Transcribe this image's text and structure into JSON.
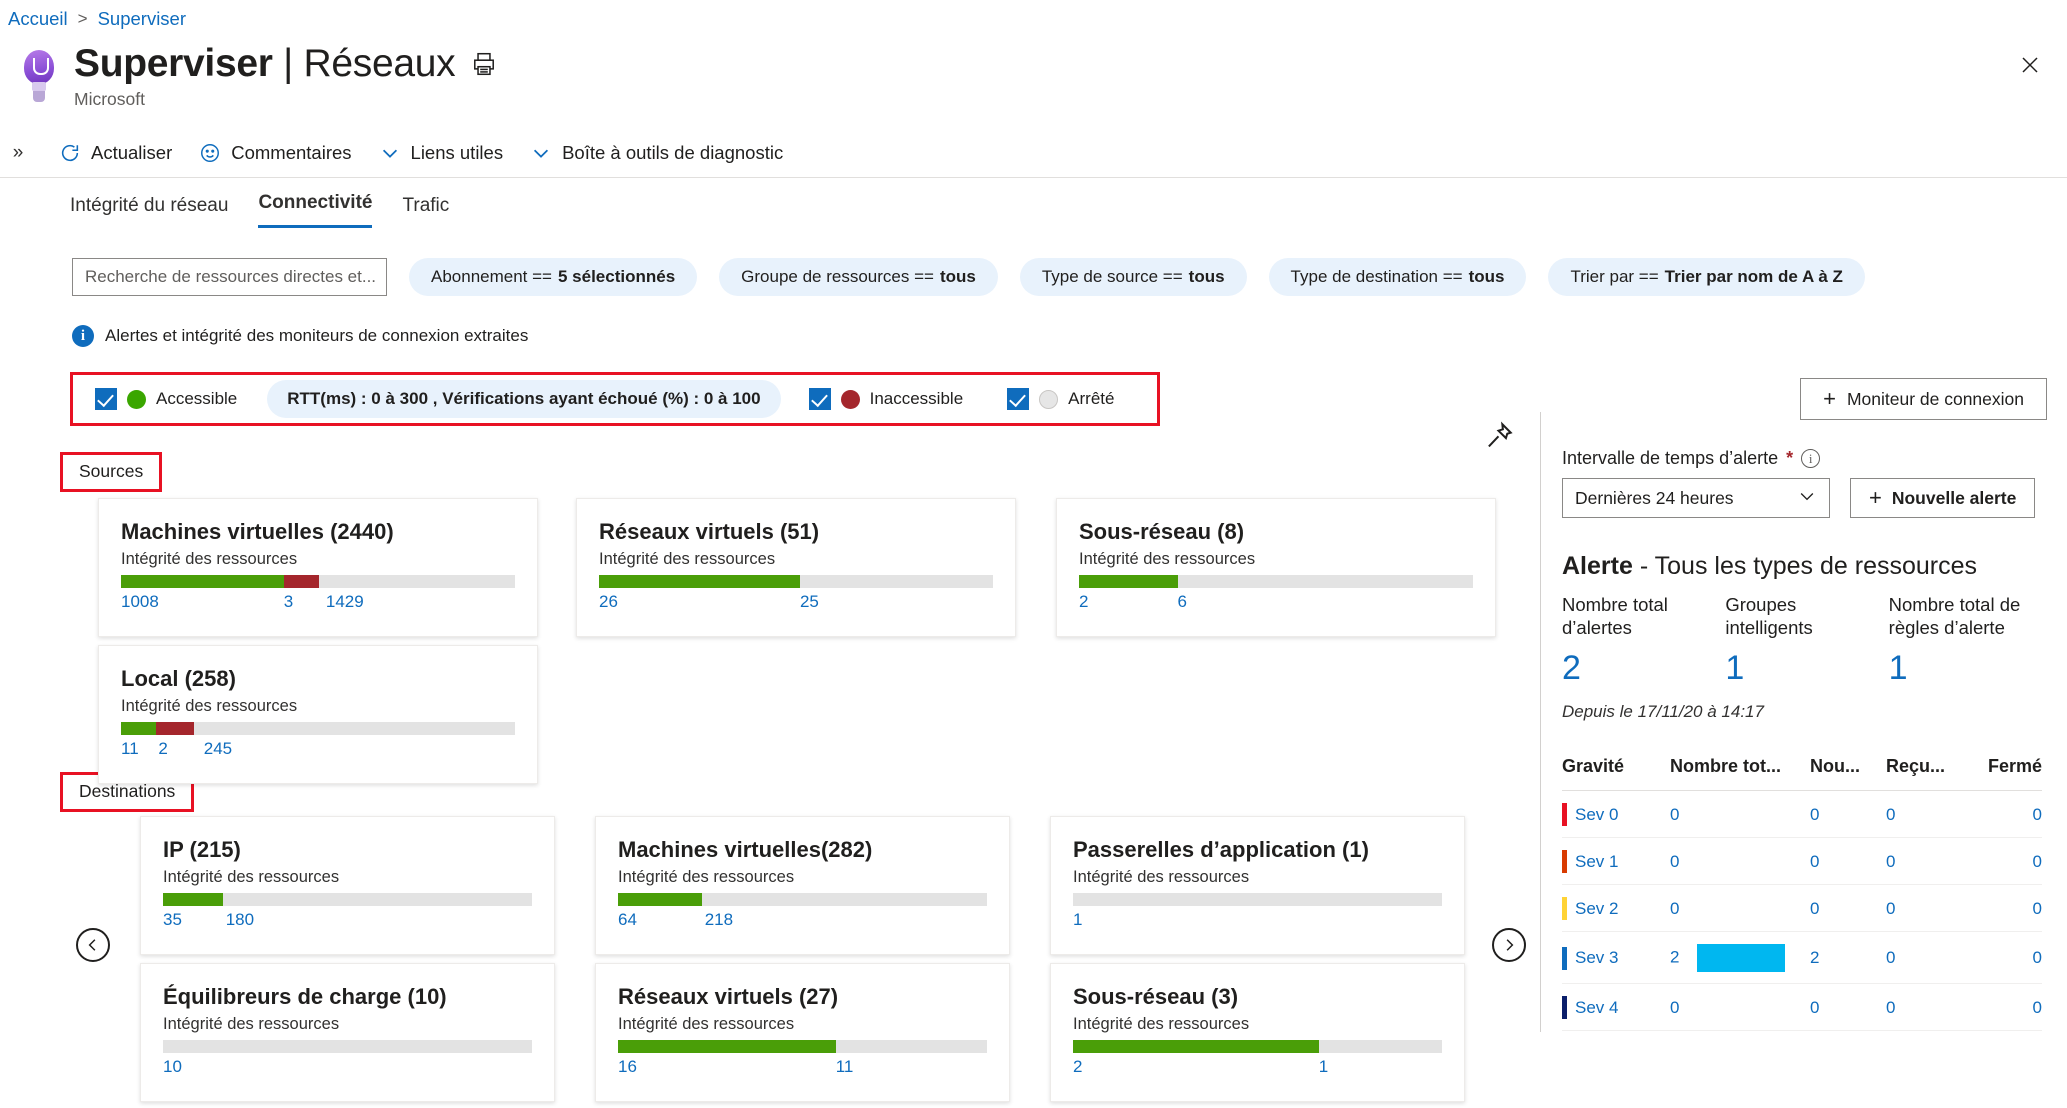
{
  "breadcrumb": {
    "home": "Accueil",
    "separator": ">",
    "current": "Superviser"
  },
  "header": {
    "title_bold": "Superviser",
    "title_rest": " | Réseaux",
    "subtitle": "Microsoft",
    "print_icon": "print-icon",
    "close_icon": "close-icon",
    "bulb_icon": "lightbulb-icon"
  },
  "commandbar": {
    "expand_label": "»",
    "items": [
      {
        "label": "Actualiser",
        "icon": "refresh-icon"
      },
      {
        "label": "Commentaires",
        "icon": "feedback-smiley-icon"
      },
      {
        "label": "Liens utiles",
        "icon": "chevron-down-icon"
      },
      {
        "label": "Boîte à outils de diagnostic",
        "icon": "chevron-down-icon"
      }
    ]
  },
  "tabs": [
    {
      "label": "Intégrité du réseau",
      "active": false
    },
    {
      "label": "Connectivité",
      "active": true
    },
    {
      "label": "Trafic",
      "active": false
    }
  ],
  "filters": {
    "search_placeholder": "Recherche de ressources directes et...",
    "pills": [
      {
        "label": "Abonnement ==",
        "value": "5 sélectionnés"
      },
      {
        "label": "Groupe de ressources ==",
        "value": "tous"
      },
      {
        "label": "Type de source ==",
        "value": "tous"
      },
      {
        "label": "Type de destination ==",
        "value": "tous"
      },
      {
        "label": "Trier par ==",
        "value": "Trier par nom de A à Z"
      }
    ]
  },
  "info_row": {
    "icon": "info-icon",
    "text": "Alertes et intégrité des moniteurs de connexion extraites"
  },
  "legend": {
    "accessible": {
      "label": "Accessible",
      "checked": true,
      "color": "#3aa600"
    },
    "rtt_pill": "RTT(ms) : 0 à 300 , Vérifications ayant échoué (%) : 0 à 100",
    "inaccessible": {
      "label": "Inaccessible",
      "checked": true,
      "color": "#a4262c"
    },
    "stopped": {
      "label": "Arrêté",
      "checked": true,
      "color": "#e6e6e6"
    }
  },
  "connection_monitor_button": {
    "label": "Moniteur de connexion",
    "icon": "plus-icon"
  },
  "pin_icon": "pin-icon",
  "sections": {
    "sources_label": "Sources",
    "destinations_label": "Destinations"
  },
  "carousel": {
    "prev_icon": "chevron-left-circle-icon",
    "next_icon": "chevron-right-circle-icon"
  },
  "chart_data": {
    "type": "bar",
    "title": "Intégrité des ressources par type de ressource (Sources et Destinations)",
    "sublabel": "Intégrité des ressources",
    "colors": {
      "healthy": "#4a9e08",
      "unhealthy": "#a4262c",
      "unknown": "#e3e3e3"
    },
    "groups": [
      {
        "name": "Sources",
        "cards": [
          {
            "title": "Machines virtuelles (2440)",
            "sub": "Intégrité des ressources",
            "total": 2440,
            "segments": [
              {
                "state": "healthy",
                "value": 1008
              },
              {
                "state": "unhealthy",
                "value": 3
              },
              {
                "state": "unknown",
                "value": 1429
              }
            ]
          },
          {
            "title": "Réseaux virtuels (51)",
            "sub": "Intégrité des ressources",
            "total": 51,
            "segments": [
              {
                "state": "healthy",
                "value": 26
              },
              {
                "state": "unknown",
                "value": 25
              }
            ]
          },
          {
            "title": "Sous-réseau (8)",
            "sub": "Intégrité des ressources",
            "total": 8,
            "segments": [
              {
                "state": "healthy",
                "value": 2
              },
              {
                "state": "unknown",
                "value": 6
              }
            ]
          },
          {
            "title": "Local (258)",
            "sub": "Intégrité des ressources",
            "total": 258,
            "segments": [
              {
                "state": "healthy",
                "value": 11
              },
              {
                "state": "unhealthy",
                "value": 2
              },
              {
                "state": "unknown",
                "value": 245
              }
            ]
          }
        ]
      },
      {
        "name": "Destinations",
        "cards": [
          {
            "title": "IP (215)",
            "sub": "Intégrité des ressources",
            "total": 215,
            "segments": [
              {
                "state": "healthy",
                "value": 35
              },
              {
                "state": "unknown",
                "value": 180
              }
            ]
          },
          {
            "title": "Machines virtuelles(282)",
            "sub": "Intégrité des ressources",
            "total": 282,
            "segments": [
              {
                "state": "healthy",
                "value": 64
              },
              {
                "state": "unknown",
                "value": 218
              }
            ]
          },
          {
            "title": "Passerelles d’application (1)",
            "sub": "Intégrité des ressources",
            "total": 1,
            "segments": [
              {
                "state": "unknown",
                "value": 1
              }
            ]
          },
          {
            "title": "Équilibreurs de charge (10)",
            "sub": "Intégrité des ressources",
            "total": 10,
            "segments": [
              {
                "state": "unknown",
                "value": 10
              }
            ]
          },
          {
            "title": "Réseaux virtuels (27)",
            "sub": "Intégrité des ressources",
            "total": 27,
            "segments": [
              {
                "state": "healthy",
                "value": 16
              },
              {
                "state": "unknown",
                "value": 11
              }
            ]
          },
          {
            "title": "Sous-réseau (3)",
            "sub": "Intégrité des ressources",
            "total": 3,
            "segments": [
              {
                "state": "healthy",
                "value": 2
              },
              {
                "state": "unknown",
                "value": 1
              }
            ]
          }
        ]
      }
    ]
  },
  "cards": {
    "s0": {
      "title": "Machines virtuelles (2440)",
      "sub": "Intégrité des ressources",
      "n0": "1008",
      "n1": "3",
      "n2": "1429"
    },
    "s1": {
      "title": "Réseaux virtuels (51)",
      "sub": "Intégrité des ressources",
      "n0": "26",
      "n1": "25"
    },
    "s2": {
      "title": "Sous-réseau (8)",
      "sub": "Intégrité des ressources",
      "n0": "2",
      "n1": "6"
    },
    "s3": {
      "title": "Local (258)",
      "sub": "Intégrité des ressources",
      "n0": "11",
      "n1": "2",
      "n2": "245"
    },
    "d0": {
      "title": "IP (215)",
      "sub": "Intégrité des ressources",
      "n0": "35",
      "n1": "180"
    },
    "d1": {
      "title": "Machines virtuelles(282)",
      "sub": "Intégrité des ressources",
      "n0": "64",
      "n1": "218"
    },
    "d2": {
      "title": "Passerelles d’application (1)",
      "sub": "Intégrité des ressources",
      "n0": "1"
    },
    "d3": {
      "title": "Équilibreurs de charge (10)",
      "sub": "Intégrité des ressources",
      "n0": "10"
    },
    "d4": {
      "title": "Réseaux virtuels (27)",
      "sub": "Intégrité des ressources",
      "n0": "16",
      "n1": "11"
    },
    "d5": {
      "title": "Sous-réseau (3)",
      "sub": "Intégrité des ressources",
      "n0": "2",
      "n1": "1"
    }
  },
  "right_panel": {
    "time_label": "Intervalle de temps d’alerte",
    "required_mark": "*",
    "selected_range": "Dernières 24 heures",
    "new_alert_label": "Nouvelle alerte",
    "alert_title_bold": "Alerte",
    "alert_title_rest": " - Tous les types de ressources",
    "kpis": [
      {
        "label": "Nombre total d’alertes",
        "value": "2"
      },
      {
        "label": "Groupes intelligents",
        "value": "1"
      },
      {
        "label": "Nombre total de règles d’alerte",
        "value": "1"
      }
    ],
    "since": "Depuis le 17/11/20 à 14:17",
    "table": {
      "headers": [
        "Gravité",
        "Nombre tot...",
        "Nou...",
        "Reçu...",
        "Fermé"
      ],
      "rows": [
        {
          "sev": "Sev 0",
          "color": "#e81123",
          "total": "0",
          "bar_pct": 0,
          "nouv": "0",
          "recu": "0",
          "ferme": "0"
        },
        {
          "sev": "Sev 1",
          "color": "#d83b01",
          "total": "0",
          "bar_pct": 0,
          "nouv": "0",
          "recu": "0",
          "ferme": "0"
        },
        {
          "sev": "Sev 2",
          "color": "#ffd335",
          "total": "0",
          "bar_pct": 0,
          "nouv": "0",
          "recu": "0",
          "ferme": "0"
        },
        {
          "sev": "Sev 3",
          "color": "#0f6cbd",
          "total": "2",
          "bar_pct": 100,
          "nouv": "2",
          "recu": "0",
          "ferme": "0"
        },
        {
          "sev": "Sev 4",
          "color": "#0b1f6b",
          "total": "0",
          "bar_pct": 0,
          "nouv": "0",
          "recu": "0",
          "ferme": "0"
        }
      ]
    }
  }
}
